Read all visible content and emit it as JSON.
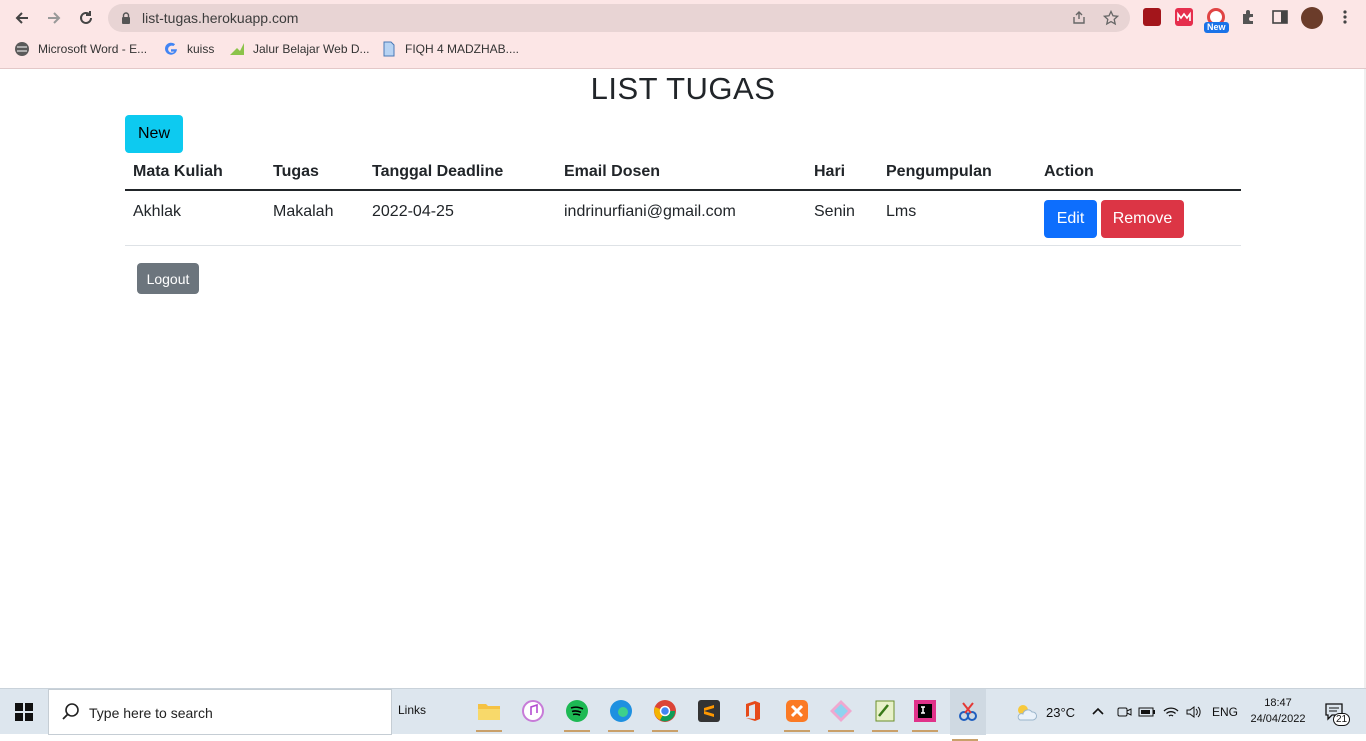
{
  "browser": {
    "url": "list-tugas.herokuapp.com",
    "extension_badge": "New",
    "bookmarks": [
      {
        "label": "Microsoft Word - E..."
      },
      {
        "label": "kuiss"
      },
      {
        "label": "Jalur Belajar Web D..."
      },
      {
        "label": "FIQH 4 MADZHAB...."
      }
    ]
  },
  "page": {
    "title": "LIST TUGAS",
    "new_button": "New",
    "logout_button": "Logout",
    "table": {
      "headers": [
        "Mata Kuliah",
        "Tugas",
        "Tanggal Deadline",
        "Email Dosen",
        "Hari",
        "Pengumpulan",
        "Action"
      ],
      "rows": [
        {
          "mata_kuliah": "Akhlak",
          "tugas": "Makalah",
          "tanggal_deadline": "2022-04-25",
          "email_dosen": "indrinurfiani@gmail.com",
          "hari": "Senin",
          "pengumpulan": "Lms",
          "edit_label": "Edit",
          "remove_label": "Remove"
        }
      ]
    }
  },
  "taskbar": {
    "search_placeholder": "Type here to search",
    "links_label": "Links",
    "temperature": "23°C",
    "language": "ENG",
    "time": "18:47",
    "date": "24/04/2022",
    "notification_count": "21"
  },
  "colors": {
    "chrome_bg": "#fce6e6",
    "btn_info": "#0dcaf0",
    "btn_primary": "#0d6efd",
    "btn_danger": "#dc3545",
    "btn_secondary": "#6c757d"
  }
}
